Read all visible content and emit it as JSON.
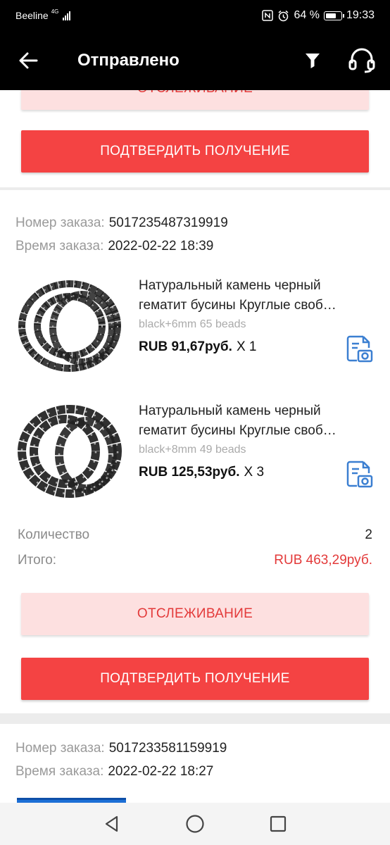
{
  "status_bar": {
    "carrier": "Beeline",
    "network": "4G",
    "battery": "64 %",
    "time": "19:33",
    "icons": [
      "signal-icon",
      "nfc-icon",
      "alarm-icon",
      "battery-icon"
    ]
  },
  "app_bar": {
    "title": "Отправлено",
    "icons": [
      "back-arrow-icon",
      "filter-icon",
      "headset-icon"
    ]
  },
  "orders": [
    {
      "track_label": "ОТСЛЕЖИВАНИЕ",
      "confirm_label": "ПОДТВЕРДИТЬ ПОЛУЧЕНИЕ"
    },
    {
      "order_number_label": "Номер заказа:",
      "order_number": "5017235487319919",
      "order_time_label": "Время заказа:",
      "order_time": "2022-02-22 18:39",
      "items": [
        {
          "title_line1": "Натуральный камень черный",
          "title_line2": "гематит бусины Круглые своб…",
          "sku": "black+6mm 65 beads",
          "price": "RUB 91,67руб.",
          "qty": "X 1"
        },
        {
          "title_line1": "Натуральный камень черный",
          "title_line2": "гематит бусины Круглые своб…",
          "sku": "black+8mm 49 beads",
          "price": "RUB 125,53руб.",
          "qty": "X 3"
        }
      ],
      "quantity_label": "Количество",
      "quantity": "2",
      "total_label": "Итого:",
      "total": "RUB 463,29руб.",
      "track_label": "ОТСЛЕЖИВАНИЕ",
      "confirm_label": "ПОДТВЕРДИТЬ ПОЛУЧЕНИЕ"
    },
    {
      "order_number_label": "Номер заказа:",
      "order_number": "5017233581159919",
      "order_time_label": "Время заказа:",
      "order_time": "2022-02-22 18:27"
    }
  ],
  "colors": {
    "accent": "#f44343",
    "track_bg": "#fde0e0",
    "total": "#e33a3a",
    "link_icon": "#3b7fd1"
  },
  "nav_bar": {
    "icons": [
      "back-triangle-icon",
      "home-circle-icon",
      "recents-square-icon"
    ]
  }
}
